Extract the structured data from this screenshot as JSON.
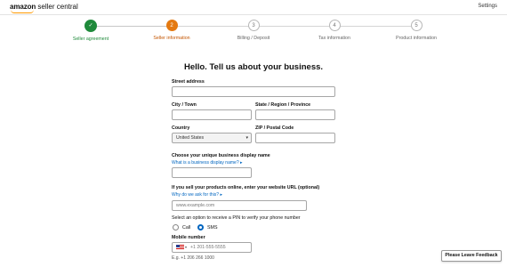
{
  "header": {
    "logo_brand": "amazon",
    "logo_suffix": "seller central",
    "settings_label": "Settings"
  },
  "stepper": {
    "steps": [
      {
        "number": "",
        "label": "Seller agreement",
        "state": "done"
      },
      {
        "number": "2",
        "label": "Seller information",
        "state": "current"
      },
      {
        "number": "3",
        "label": "Billing / Deposit",
        "state": "todo"
      },
      {
        "number": "4",
        "label": "Tax information",
        "state": "todo"
      },
      {
        "number": "5",
        "label": "Product information",
        "state": "todo"
      }
    ]
  },
  "form": {
    "title": "Hello. Tell us about your business.",
    "street": {
      "label": "Street address",
      "value": ""
    },
    "city": {
      "label": "City / Town",
      "value": ""
    },
    "state": {
      "label": "State / Region / Province",
      "value": ""
    },
    "country": {
      "label": "Country",
      "value": "United States"
    },
    "zip": {
      "label": "ZIP / Postal Code",
      "value": ""
    },
    "display_name": {
      "label": "Choose your unique business display name",
      "help_link": "What is a business display name?",
      "value": ""
    },
    "website": {
      "label": "If you sell your products online, enter your website URL (optional)",
      "help_link": "Why do we ask for this?",
      "placeholder": "www.example.com"
    },
    "pin": {
      "label": "Select an option to receive a PIN to verify your phone number",
      "options": [
        {
          "label": "Call",
          "selected": false
        },
        {
          "label": "SMS",
          "selected": true
        }
      ]
    },
    "mobile": {
      "label": "Mobile number",
      "placeholder": "+1 201-555-5555",
      "example": "E.g. +1 206 266 1000"
    }
  },
  "feedback_button": {
    "label": "Please Leave Feedback"
  },
  "colors": {
    "done": "#1f8a3b",
    "current": "#e47911",
    "link": "#0066c0"
  }
}
